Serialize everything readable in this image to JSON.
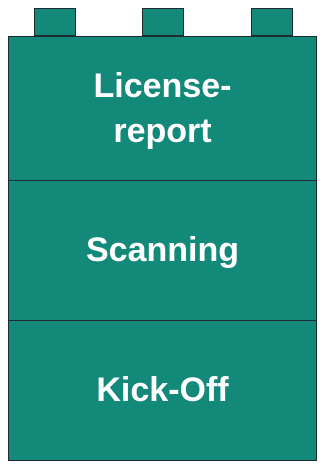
{
  "colors": {
    "fill": "#138a79",
    "edge": "#1f2a30",
    "text": "#ffffff"
  },
  "blocks": [
    {
      "line1": "License-",
      "line2": "report"
    },
    {
      "line1": "Scanning"
    },
    {
      "line1": "Kick-Off"
    }
  ]
}
